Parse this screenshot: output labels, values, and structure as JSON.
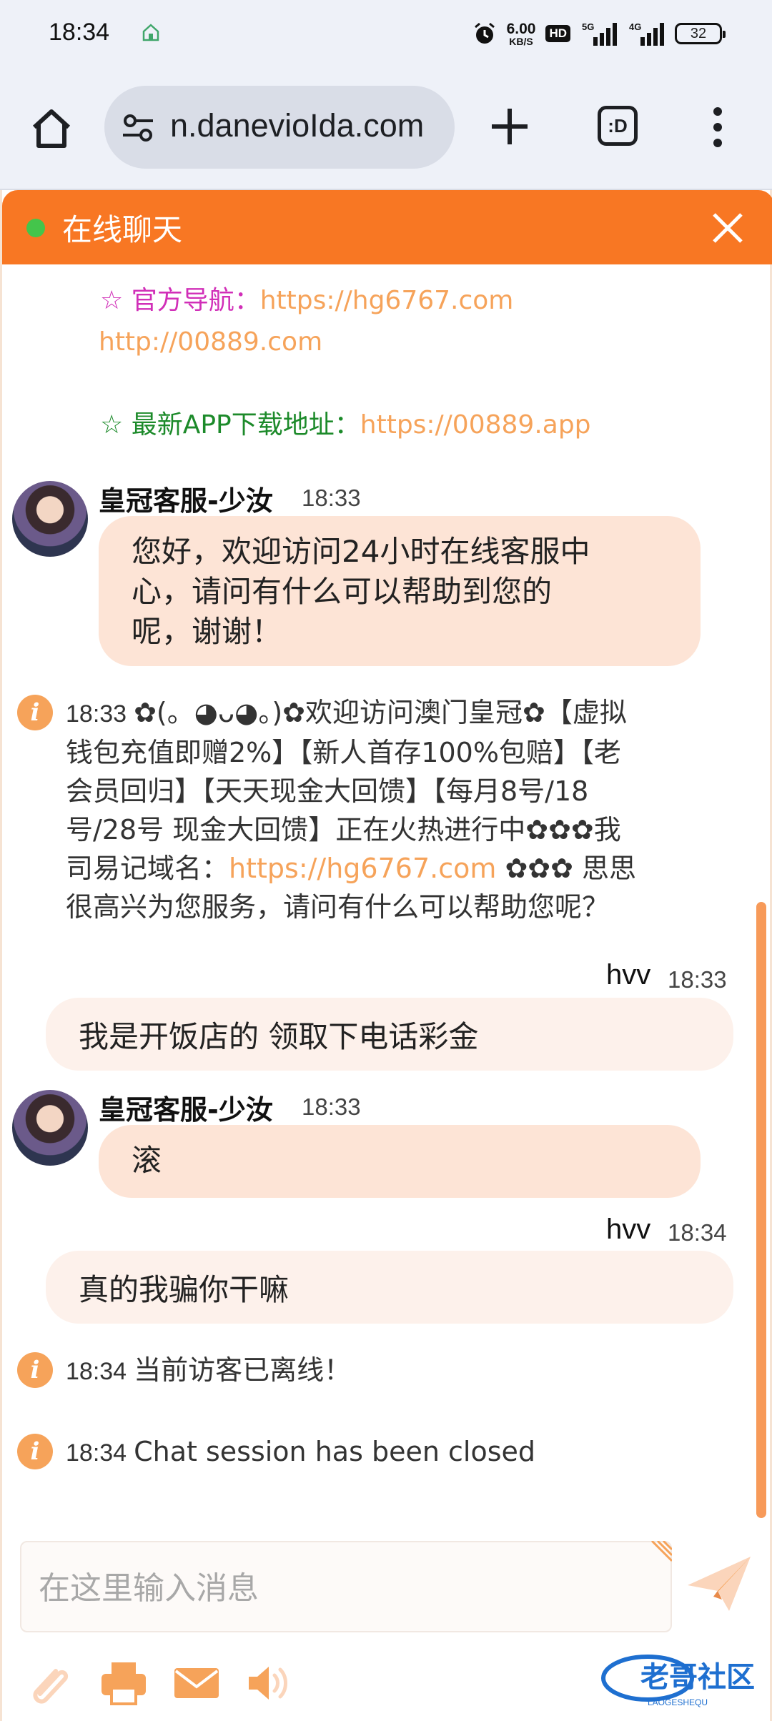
{
  "status_bar": {
    "time": "18:34",
    "net_speed_value": "6.00",
    "net_speed_unit": "KB/S",
    "hd_label": "HD",
    "signal_1": "5G",
    "signal_2": "4G",
    "battery": "32"
  },
  "browser": {
    "url": "n.danevioIda.com",
    "tabs_label": ":D"
  },
  "chat": {
    "header_title": "在线聊天",
    "notices": [
      {
        "label": "☆ 官方导航：",
        "link": "https://hg6767.com",
        "link2": "http://00889.com",
        "color": "#d12fb8"
      },
      {
        "label": "☆ 最新APP下载地址：",
        "link": "https://00889.app",
        "color": "#1c8a2a"
      }
    ],
    "messages": [
      {
        "sender": "皇冠客服-少汝",
        "time": "18:33",
        "lines": [
          "您好，欢迎访问24小时在线客服中",
          "心，请问有什么可以帮助到您的",
          "呢，谢谢！"
        ]
      },
      {
        "time": "18:33",
        "system_lines": [
          "✿(。◕ᴗ◕。)✿欢迎访问澳门皇冠✿【虚拟",
          "钱包充值即赠2%】【新人首存100%包赔】【老",
          "会员回归】【天天现金大回馈】【每月8号/18",
          "号/28号 现金大回馈】正在火热进行中✿✿✿我",
          "司易记域名："
        ],
        "system_link": "https://hg6767.com",
        "system_tail": " ✿✿✿ 思思",
        "system_last": "很高兴为您服务，请问有什么可以帮助您呢？"
      },
      {
        "sender": "hvv",
        "time": "18:33",
        "text": "我是开饭店的  领取下电话彩金"
      },
      {
        "sender": "皇冠客服-少汝",
        "time": "18:33",
        "text": "滚"
      },
      {
        "sender": "hvv",
        "time": "18:34",
        "text": "真的我骗你干嘛"
      },
      {
        "time": "18:34",
        "text": "当前访客已离线！"
      },
      {
        "time": "18:34",
        "text": "Chat session has been closed"
      }
    ],
    "input_placeholder": "在这里输入消息",
    "watermark_text": "老哥社区",
    "watermark_sub": "LAOGESHEQU"
  },
  "colors": {
    "header": "#f87723",
    "online_dot": "#44c54b",
    "agent_bubble": "#fde4d6",
    "user_bubble": "#fdf1eb",
    "link": "#f6a35a",
    "icon_accent": "#f6a35a"
  },
  "icons": [
    "home-icon",
    "tune-icon",
    "plus-icon",
    "more-icon",
    "close-icon",
    "info-icon",
    "send-icon",
    "attach-icon",
    "print-icon",
    "mail-icon",
    "sound-icon"
  ]
}
